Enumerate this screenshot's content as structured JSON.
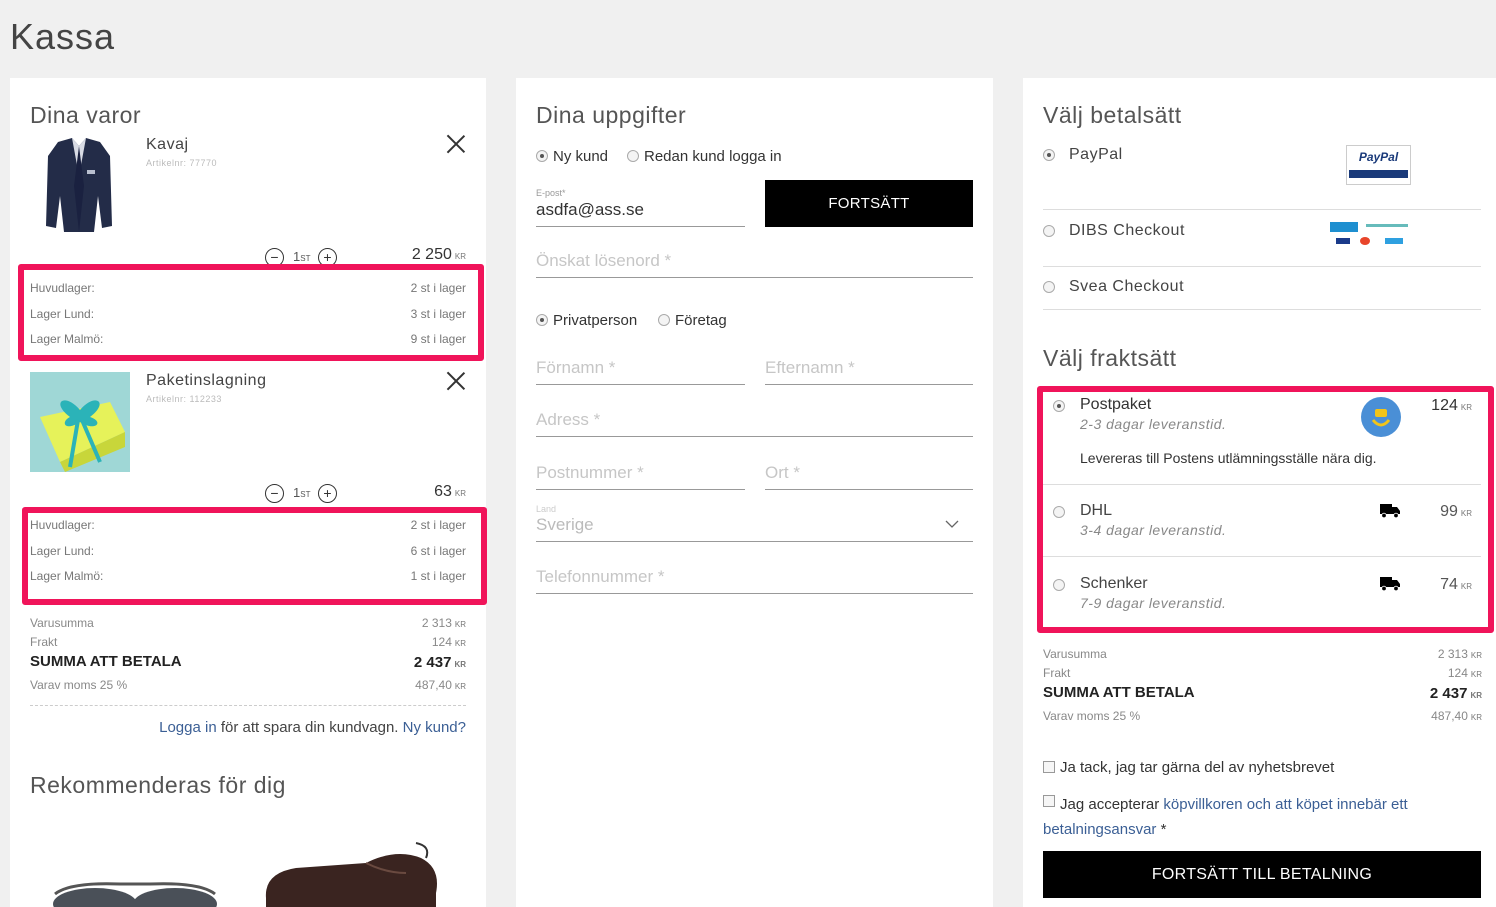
{
  "page": {
    "title": "Kassa"
  },
  "cart": {
    "heading": "Dina varor",
    "items": [
      {
        "name": "Kavaj",
        "article": "Artikelnr: 77770",
        "qty": "1",
        "qty_unit": "ST",
        "price": "2 250",
        "currency": "KR",
        "stock": [
          {
            "label": "Huvudlager:",
            "value": "2 st i lager"
          },
          {
            "label": "Lager Lund:",
            "value": "3 st i lager"
          },
          {
            "label": "Lager Malmö:",
            "value": "9 st i lager"
          }
        ]
      },
      {
        "name": "Paketinslagning",
        "article": "Artikelnr: 112233",
        "qty": "1",
        "qty_unit": "ST",
        "price": "63",
        "currency": "KR",
        "stock": [
          {
            "label": "Huvudlager:",
            "value": "2 st i lager"
          },
          {
            "label": "Lager Lund:",
            "value": "6 st i lager"
          },
          {
            "label": "Lager Malmö:",
            "value": "1 st i lager"
          }
        ]
      }
    ],
    "summary": {
      "subtotal_label": "Varusumma",
      "subtotal": "2 313",
      "shipping_label": "Frakt",
      "shipping": "124",
      "total_label": "SUMMA ATT BETALA",
      "total": "2 437",
      "vat_label": "Varav moms 25 %",
      "vat": "487,40",
      "currency": "KR"
    },
    "login_link": "Logga in",
    "login_text": " för att spara din kundvagn. ",
    "new_customer_link": "Ny kund?",
    "recommend_heading": "Rekommenderas för dig"
  },
  "details": {
    "heading": "Dina uppgifter",
    "customer_type": [
      "Ny kund",
      "Redan kund logga in"
    ],
    "email_label": "E-post*",
    "email_value": "asdfa@ass.se",
    "continue_button": "FORTSÄTT",
    "password_placeholder": "Önskat lösenord *",
    "person_type": [
      "Privatperson",
      "Företag"
    ],
    "firstname_placeholder": "Förnamn *",
    "lastname_placeholder": "Efternamn *",
    "address_placeholder": "Adress *",
    "zip_placeholder": "Postnummer *",
    "city_placeholder": "Ort *",
    "country_label": "Land",
    "country_value": "Sverige",
    "phone_placeholder": "Telefonnummer *"
  },
  "payment": {
    "heading": "Välj betalsätt",
    "methods": [
      {
        "name": "PayPal",
        "logo": "paypal-logo"
      },
      {
        "name": "DIBS Checkout",
        "logo": "dibs-logo"
      },
      {
        "name": "Svea Checkout",
        "logo": ""
      }
    ],
    "paypal_text": "PayPal"
  },
  "shipping": {
    "heading": "Välj fraktsätt",
    "options": [
      {
        "name": "Postpaket",
        "eta": "2-3 dagar leveranstid.",
        "price": "124",
        "currency": "KR",
        "note": "Levereras till Postens utlämningsställe nära dig.",
        "icon": "postnord-icon"
      },
      {
        "name": "DHL",
        "eta": "3-4 dagar leveranstid.",
        "price": "99",
        "currency": "KR",
        "icon": "truck-icon"
      },
      {
        "name": "Schenker",
        "eta": "7-9 dagar leveranstid.",
        "price": "74",
        "currency": "KR",
        "icon": "truck-icon"
      }
    ]
  },
  "checkout": {
    "summary": {
      "subtotal_label": "Varusumma",
      "subtotal": "2 313",
      "shipping_label": "Frakt",
      "shipping": "124",
      "total_label": "SUMMA ATT BETALA",
      "total": "2 437",
      "vat_label": "Varav moms 25 %",
      "vat": "487,40",
      "currency": "KR"
    },
    "newsletter_label": "Ja tack, jag tar gärna del av nyhetsbrevet",
    "terms_prefix": "Jag accepterar ",
    "terms_link": "köpvillkoren och att köpet innebär ett betalningsansvar",
    "terms_suffix": " *",
    "submit_button": "FORTSÄTT TILL BETALNING"
  },
  "colors": {
    "highlight": "#f0145a",
    "link": "#3b5f95",
    "button": "#000000"
  }
}
